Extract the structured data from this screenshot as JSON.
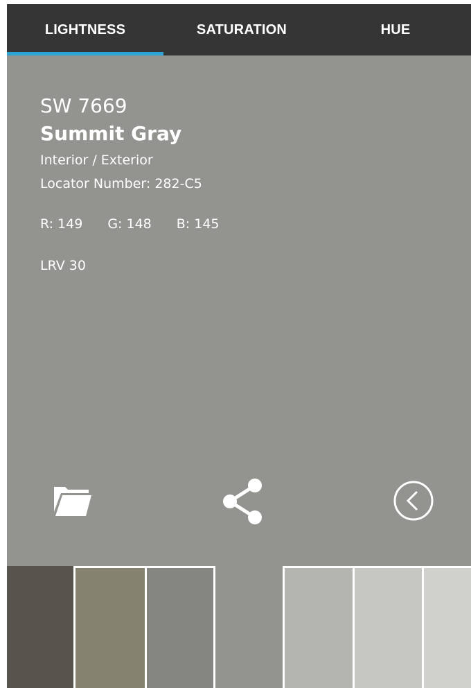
{
  "tabs": [
    {
      "label": "LIGHTNESS",
      "active": true
    },
    {
      "label": "SATURATION",
      "active": false
    },
    {
      "label": "HUE",
      "active": false
    }
  ],
  "colors": {
    "tabbar": "#353535",
    "tab_indicator": "#2ea3d6",
    "swatch_background": "#93938f"
  },
  "color_detail": {
    "number": "SW 7669",
    "name": "Summit Gray",
    "usage": "Interior / Exterior",
    "locator": "Locator Number: 282-C5",
    "rgb": {
      "r": "R: 149",
      "g": "G: 148",
      "b": "B: 145"
    },
    "lrv": "LRV 30"
  },
  "actions": {
    "folder_icon": "folder-icon",
    "share_icon": "share-icon",
    "back_icon": "chevron-left-circle-icon"
  },
  "swatch_strip": [
    {
      "color": "#56544d"
    },
    {
      "color": "#858370"
    },
    {
      "color": "#858681"
    },
    {
      "color": "#93938f",
      "current": true
    },
    {
      "color": "#b4b4b0"
    },
    {
      "color": "#c6c6c2"
    },
    {
      "color": "#d0d0cc"
    }
  ]
}
